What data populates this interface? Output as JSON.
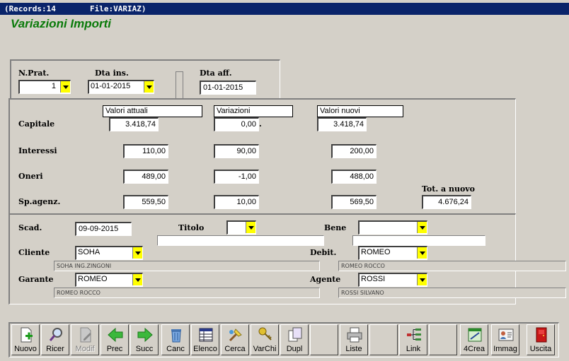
{
  "titlebar": {
    "records": "(Records:14",
    "file": "File:VARIAZ)"
  },
  "app_title": "Variazioni Importi",
  "header": {
    "npra_label": "N.Prat.",
    "npra_value": "1",
    "dta_ins_label": "Dta ins.",
    "dta_ins_value": "01-01-2015",
    "dta_aff_label": "Dta aff.",
    "dta_aff_value": "01-01-2015"
  },
  "grid": {
    "col_current": "Valori attuali",
    "col_changes": "Variazioni",
    "col_new": "Valori nuovi",
    "rows": [
      {
        "label": "Capitale",
        "current": "3.418,74",
        "change": "0,00",
        "new": "3.418,74"
      },
      {
        "label": "Interessi",
        "current": "110,00",
        "change": "90,00",
        "new": "200,00"
      },
      {
        "label": "Oneri",
        "current": "489,00",
        "change": "-1,00",
        "new": "488,00"
      },
      {
        "label": "Sp.agenz.",
        "current": "559,50",
        "change": "10,00",
        "new": "569,50"
      }
    ],
    "dot": ".",
    "tot_label": "Tot. a nuovo",
    "tot_value": "4.676,24"
  },
  "details": {
    "scad_label": "Scad.",
    "scad_value": "09-09-2015",
    "titolo_label": "Titolo",
    "titolo_value": "",
    "bene_label": "Bene",
    "bene_value": "",
    "cliente_label": "Cliente",
    "cliente_value": "SOHA",
    "cliente_desc": "SOHA ING.ZINGONI",
    "debit_label": "Debit.",
    "debit_value": "ROMEO",
    "debit_desc": "ROMEO ROCCO",
    "garante_label": "Garante",
    "garante_value": "ROMEO",
    "garante_desc": "ROMEO ROCCO",
    "agente_label": "Agente",
    "agente_value": "ROSSI",
    "agente_desc": "ROSSI SILVANO"
  },
  "toolbar": {
    "nuovo": "Nuovo",
    "ricer": "Ricer",
    "modif": "Modif",
    "prec": "Prec",
    "succ": "Succ",
    "canc": "Canc",
    "elenco": "Elenco",
    "cerca": "Cerca",
    "varchi": "VarChi",
    "dupl": "Dupl",
    "liste": "Liste",
    "link": "Link",
    "crea": "4Crea",
    "immag": "Immag",
    "uscita": "Uscita"
  },
  "colors": {
    "accent_green": "#0a7a0a",
    "dropdown_yellow": "#ffff00",
    "titlebar": "#0a246a"
  }
}
